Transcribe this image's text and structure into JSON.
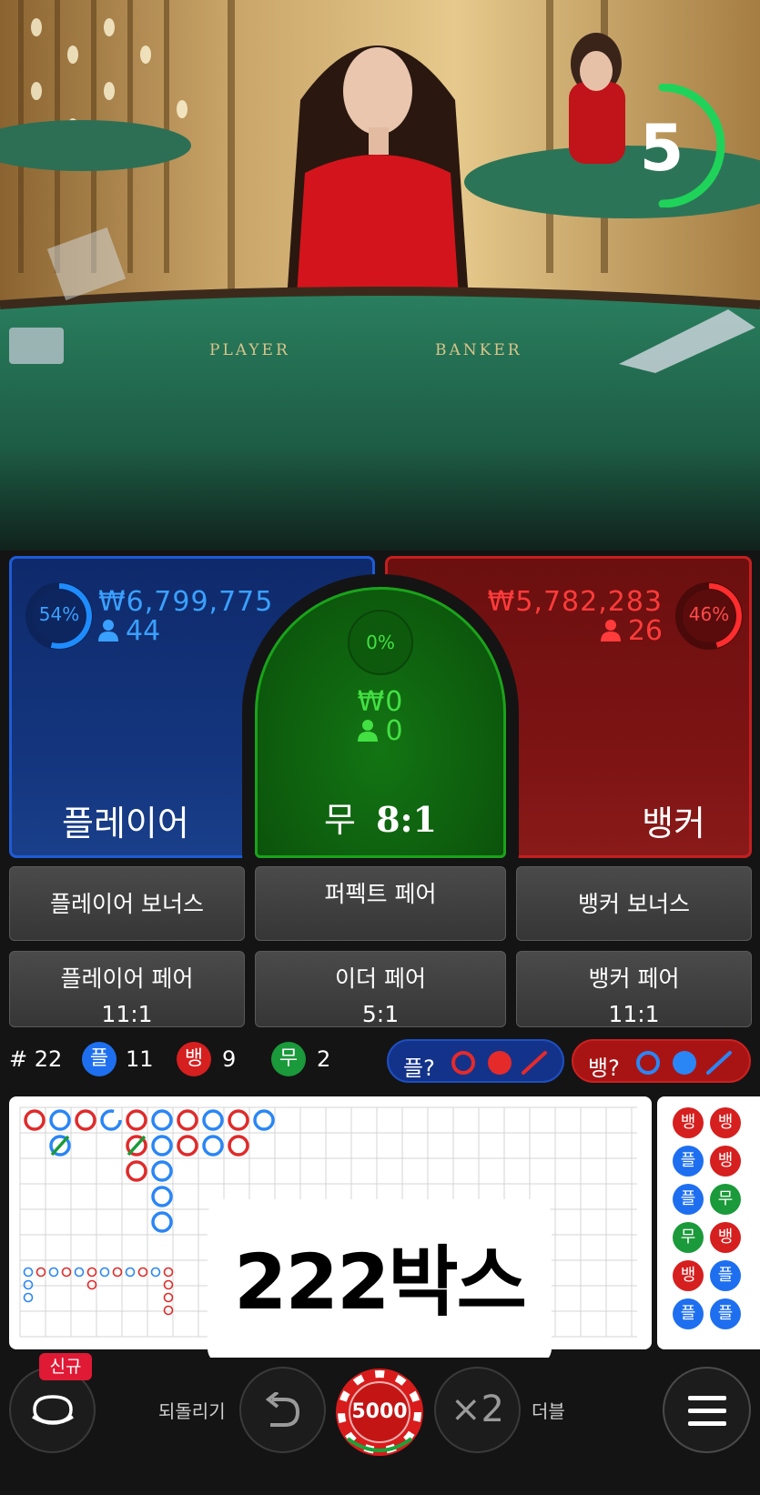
{
  "timer": {
    "seconds": "5",
    "remaining_fraction": 0.45
  },
  "video": {
    "table_player_text": "PLAYER",
    "table_banker_text": "BANKER"
  },
  "bets": {
    "player": {
      "percent": "54%",
      "percent_value": 0.54,
      "amount": "₩6,799,775",
      "bettors": "44",
      "label": "플레이어"
    },
    "tie": {
      "percent": "0%",
      "amount": "₩0",
      "bettors": "0",
      "label": "무",
      "odds": "8:1"
    },
    "banker": {
      "percent": "46%",
      "percent_value": 0.46,
      "amount": "₩5,782,283",
      "bettors": "26",
      "label": "뱅커"
    }
  },
  "side_bets": {
    "player_bonus": "플레이어 보너스",
    "perfect_pair": "퍼펙트 페어",
    "banker_bonus": "뱅커 보너스",
    "player_pair": {
      "label": "플레이어 페어",
      "odds": "11:1"
    },
    "either_pair": {
      "label": "이더 페어",
      "odds": "5:1"
    },
    "banker_pair": {
      "label": "뱅커 페어",
      "odds": "11:1"
    }
  },
  "stats": {
    "round": "# 22",
    "player_symbol": "플",
    "player_count": "11",
    "banker_symbol": "뱅",
    "banker_count": "9",
    "tie_symbol": "무",
    "tie_count": "2",
    "player_predict": "플?",
    "banker_predict": "뱅?"
  },
  "colors": {
    "player": "#1e6ff0",
    "banker": "#d61f1f",
    "tie": "#1a9a3a"
  },
  "road_right": [
    [
      "뱅",
      "뱅"
    ],
    [
      "플",
      "뱅"
    ],
    [
      "플",
      "무"
    ],
    [
      "무",
      "뱅"
    ],
    [
      "뱅",
      "플"
    ],
    [
      "플",
      "플"
    ]
  ],
  "promo": {
    "text": "222박스"
  },
  "bottom": {
    "new_badge": "신규",
    "undo_label": "되돌리기",
    "chip_value": "5000",
    "double_symbol": "×2",
    "double_label": "더블"
  },
  "icons": [
    "timer-ring",
    "person-icon",
    "undo-icon",
    "double-icon",
    "menu-icon",
    "lobby-icon"
  ]
}
